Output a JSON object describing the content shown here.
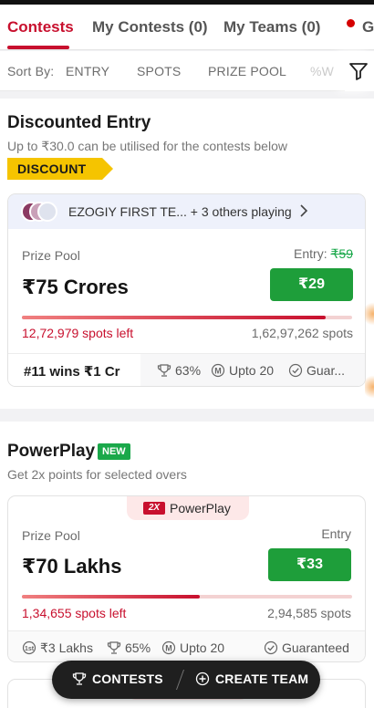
{
  "tabs": [
    {
      "label": "Contests",
      "active": true
    },
    {
      "label": "My Contests (0)",
      "active": false
    },
    {
      "label": "My Teams (0)",
      "active": false
    },
    {
      "label": "Gr",
      "active": false
    }
  ],
  "sort": {
    "label": "Sort By:",
    "items": [
      "ENTRY",
      "SPOTS",
      "PRIZE POOL",
      "%W"
    ],
    "filter_icon": "filter-icon"
  },
  "discounted": {
    "title": "Discounted Entry",
    "subtitle": "Up to ₹30.0 can be utilised for the contests below",
    "tag": "DISCOUNT",
    "card": {
      "players_text": "EZOGIY FIRST TE... + 3 others playing",
      "prize_pool_label": "Prize Pool",
      "prize_pool": "₹75 Crores",
      "entry_label": "Entry:",
      "entry_original": "₹59",
      "entry_price": "₹29",
      "fill_fraction": 0.92,
      "spots_left": "12,72,979 spots left",
      "spots_total": "1,62,97,262 spots",
      "first_prize": "#11 wins ₹1 Cr",
      "win_percent": "63%",
      "max_entries": "Upto 20",
      "guarantee": "Guar..."
    }
  },
  "powerplay": {
    "title": "PowerPlay",
    "badge": "NEW",
    "subtitle": "Get 2x points for selected overs",
    "card": {
      "ribbon_logo": "2X",
      "ribbon_text": "PowerPlay",
      "prize_pool_label": "Prize Pool",
      "prize_pool": "₹70 Lakhs",
      "entry_label": "Entry",
      "entry_price": "₹33",
      "fill_fraction": 0.54,
      "spots_left": "1,34,655 spots left",
      "spots_total": "2,94,585 spots",
      "first_prize": "₹3 Lakhs",
      "win_percent": "65%",
      "max_entries": "Upto 20",
      "guarantee": "Guaranteed"
    }
  },
  "bottom_pill": {
    "contests_label": "CONTESTS",
    "create_team_label": "CREATE TEAM"
  },
  "colors": {
    "brand_red": "#c8102e",
    "join_green": "#1e9e3a",
    "discount_yellow": "#f5c400",
    "new_green": "#1aa84a"
  }
}
